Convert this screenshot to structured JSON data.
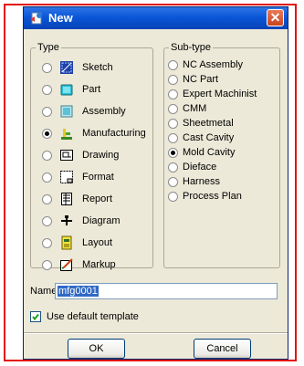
{
  "dialog": {
    "title": "New",
    "close_glyph": "✕",
    "colors": {
      "title_bar": "#0a56d8",
      "close_button": "#d95b35",
      "frame": "#e3140f",
      "selection": "#316ac5"
    }
  },
  "type_group": {
    "legend": "Type",
    "items": [
      {
        "label": "Sketch",
        "icon": "sketch-icon",
        "selected": false
      },
      {
        "label": "Part",
        "icon": "part-icon",
        "selected": false
      },
      {
        "label": "Assembly",
        "icon": "assembly-icon",
        "selected": false
      },
      {
        "label": "Manufacturing",
        "icon": "manufacturing-icon",
        "selected": true
      },
      {
        "label": "Drawing",
        "icon": "drawing-icon",
        "selected": false
      },
      {
        "label": "Format",
        "icon": "format-icon",
        "selected": false
      },
      {
        "label": "Report",
        "icon": "report-icon",
        "selected": false
      },
      {
        "label": "Diagram",
        "icon": "diagram-icon",
        "selected": false
      },
      {
        "label": "Layout",
        "icon": "layout-icon",
        "selected": false
      },
      {
        "label": "Markup",
        "icon": "markup-icon",
        "selected": false
      }
    ]
  },
  "subtype_group": {
    "legend": "Sub-type",
    "items": [
      {
        "label": "NC Assembly",
        "selected": false
      },
      {
        "label": "NC Part",
        "selected": false
      },
      {
        "label": "Expert Machinist",
        "selected": false
      },
      {
        "label": "CMM",
        "selected": false
      },
      {
        "label": "Sheetmetal",
        "selected": false
      },
      {
        "label": "Cast Cavity",
        "selected": false
      },
      {
        "label": "Mold Cavity",
        "selected": true
      },
      {
        "label": "Dieface",
        "selected": false
      },
      {
        "label": "Harness",
        "selected": false
      },
      {
        "label": "Process Plan",
        "selected": false
      }
    ]
  },
  "name_field": {
    "label": "Name",
    "value": "mfg0001"
  },
  "template_option": {
    "label": "Use default template",
    "checked": true
  },
  "buttons": {
    "ok": "OK",
    "cancel": "Cancel"
  }
}
